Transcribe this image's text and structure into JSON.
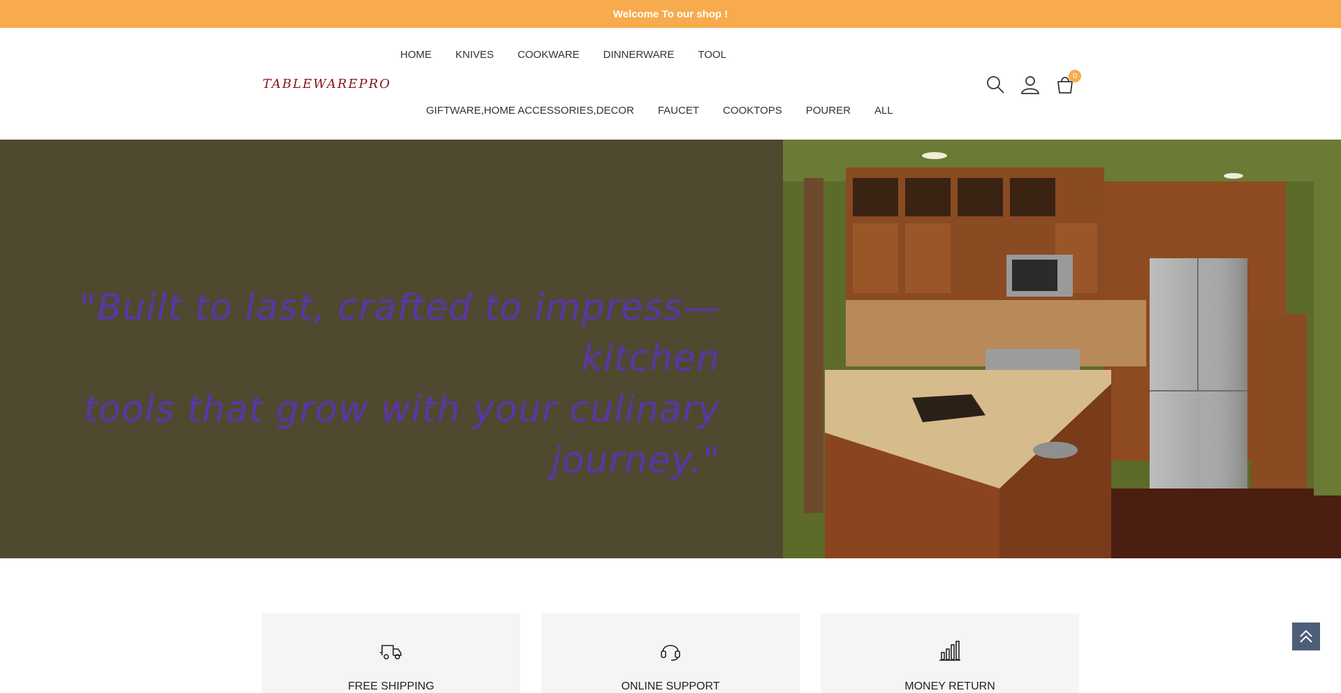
{
  "announcement": "Welcome To our shop !",
  "logo": "TABLEWAREPRO",
  "nav": {
    "row1": [
      "HOME",
      "KNIVES",
      "COOKWARE",
      "DINNERWARE",
      "TOOL"
    ],
    "row2": [
      "GIFTWARE,HOME ACCESSORIES,DECOR",
      "FAUCET",
      "COOKTOPS",
      "POURER",
      "ALL"
    ]
  },
  "icons": {
    "search": "search-icon",
    "account": "user-icon",
    "cart": "cart-icon",
    "cart_count": "0"
  },
  "hero": {
    "quote_line1": "\"Built to last, crafted to impress—kitchen",
    "quote_line2": "tools that grow with your culinary journey.\""
  },
  "features": [
    {
      "title": "FREE SHIPPING",
      "icon": "truck-icon"
    },
    {
      "title": "ONLINE SUPPORT",
      "icon": "headset-icon"
    },
    {
      "title": "MONEY RETURN",
      "icon": "bar-chart-icon"
    }
  ],
  "colors": {
    "accent": "#f7ab4c",
    "hero_bg": "#4f4930",
    "quote": "#5c35a8",
    "logo": "#8a1212",
    "scroll_top_bg": "#4d5e78"
  }
}
